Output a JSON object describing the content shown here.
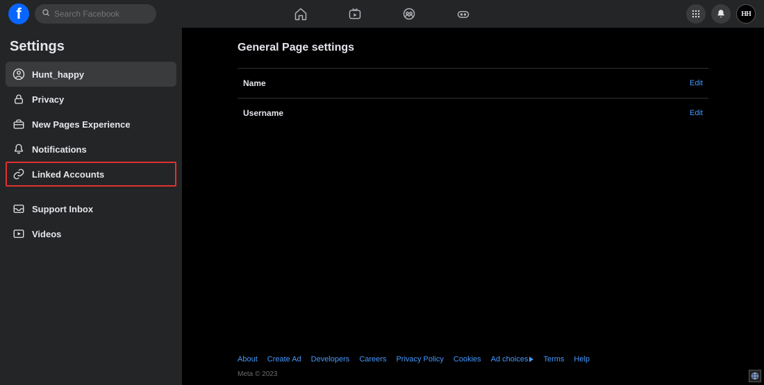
{
  "topnav": {
    "search_placeholder": "Search Facebook",
    "avatar_initials": "HH"
  },
  "sidebar": {
    "title": "Settings",
    "items": [
      {
        "label": "Hunt_happy"
      },
      {
        "label": "Privacy"
      },
      {
        "label": "New Pages Experience"
      },
      {
        "label": "Notifications"
      },
      {
        "label": "Linked Accounts"
      },
      {
        "label": "Support Inbox"
      },
      {
        "label": "Videos"
      }
    ]
  },
  "main": {
    "title": "General Page settings",
    "rows": [
      {
        "label": "Name",
        "action": "Edit"
      },
      {
        "label": "Username",
        "action": "Edit"
      }
    ]
  },
  "footer": {
    "links": [
      "About",
      "Create Ad",
      "Developers",
      "Careers",
      "Privacy Policy",
      "Cookies",
      "Ad choices",
      "Terms",
      "Help"
    ],
    "copyright": "Meta © 2023"
  }
}
